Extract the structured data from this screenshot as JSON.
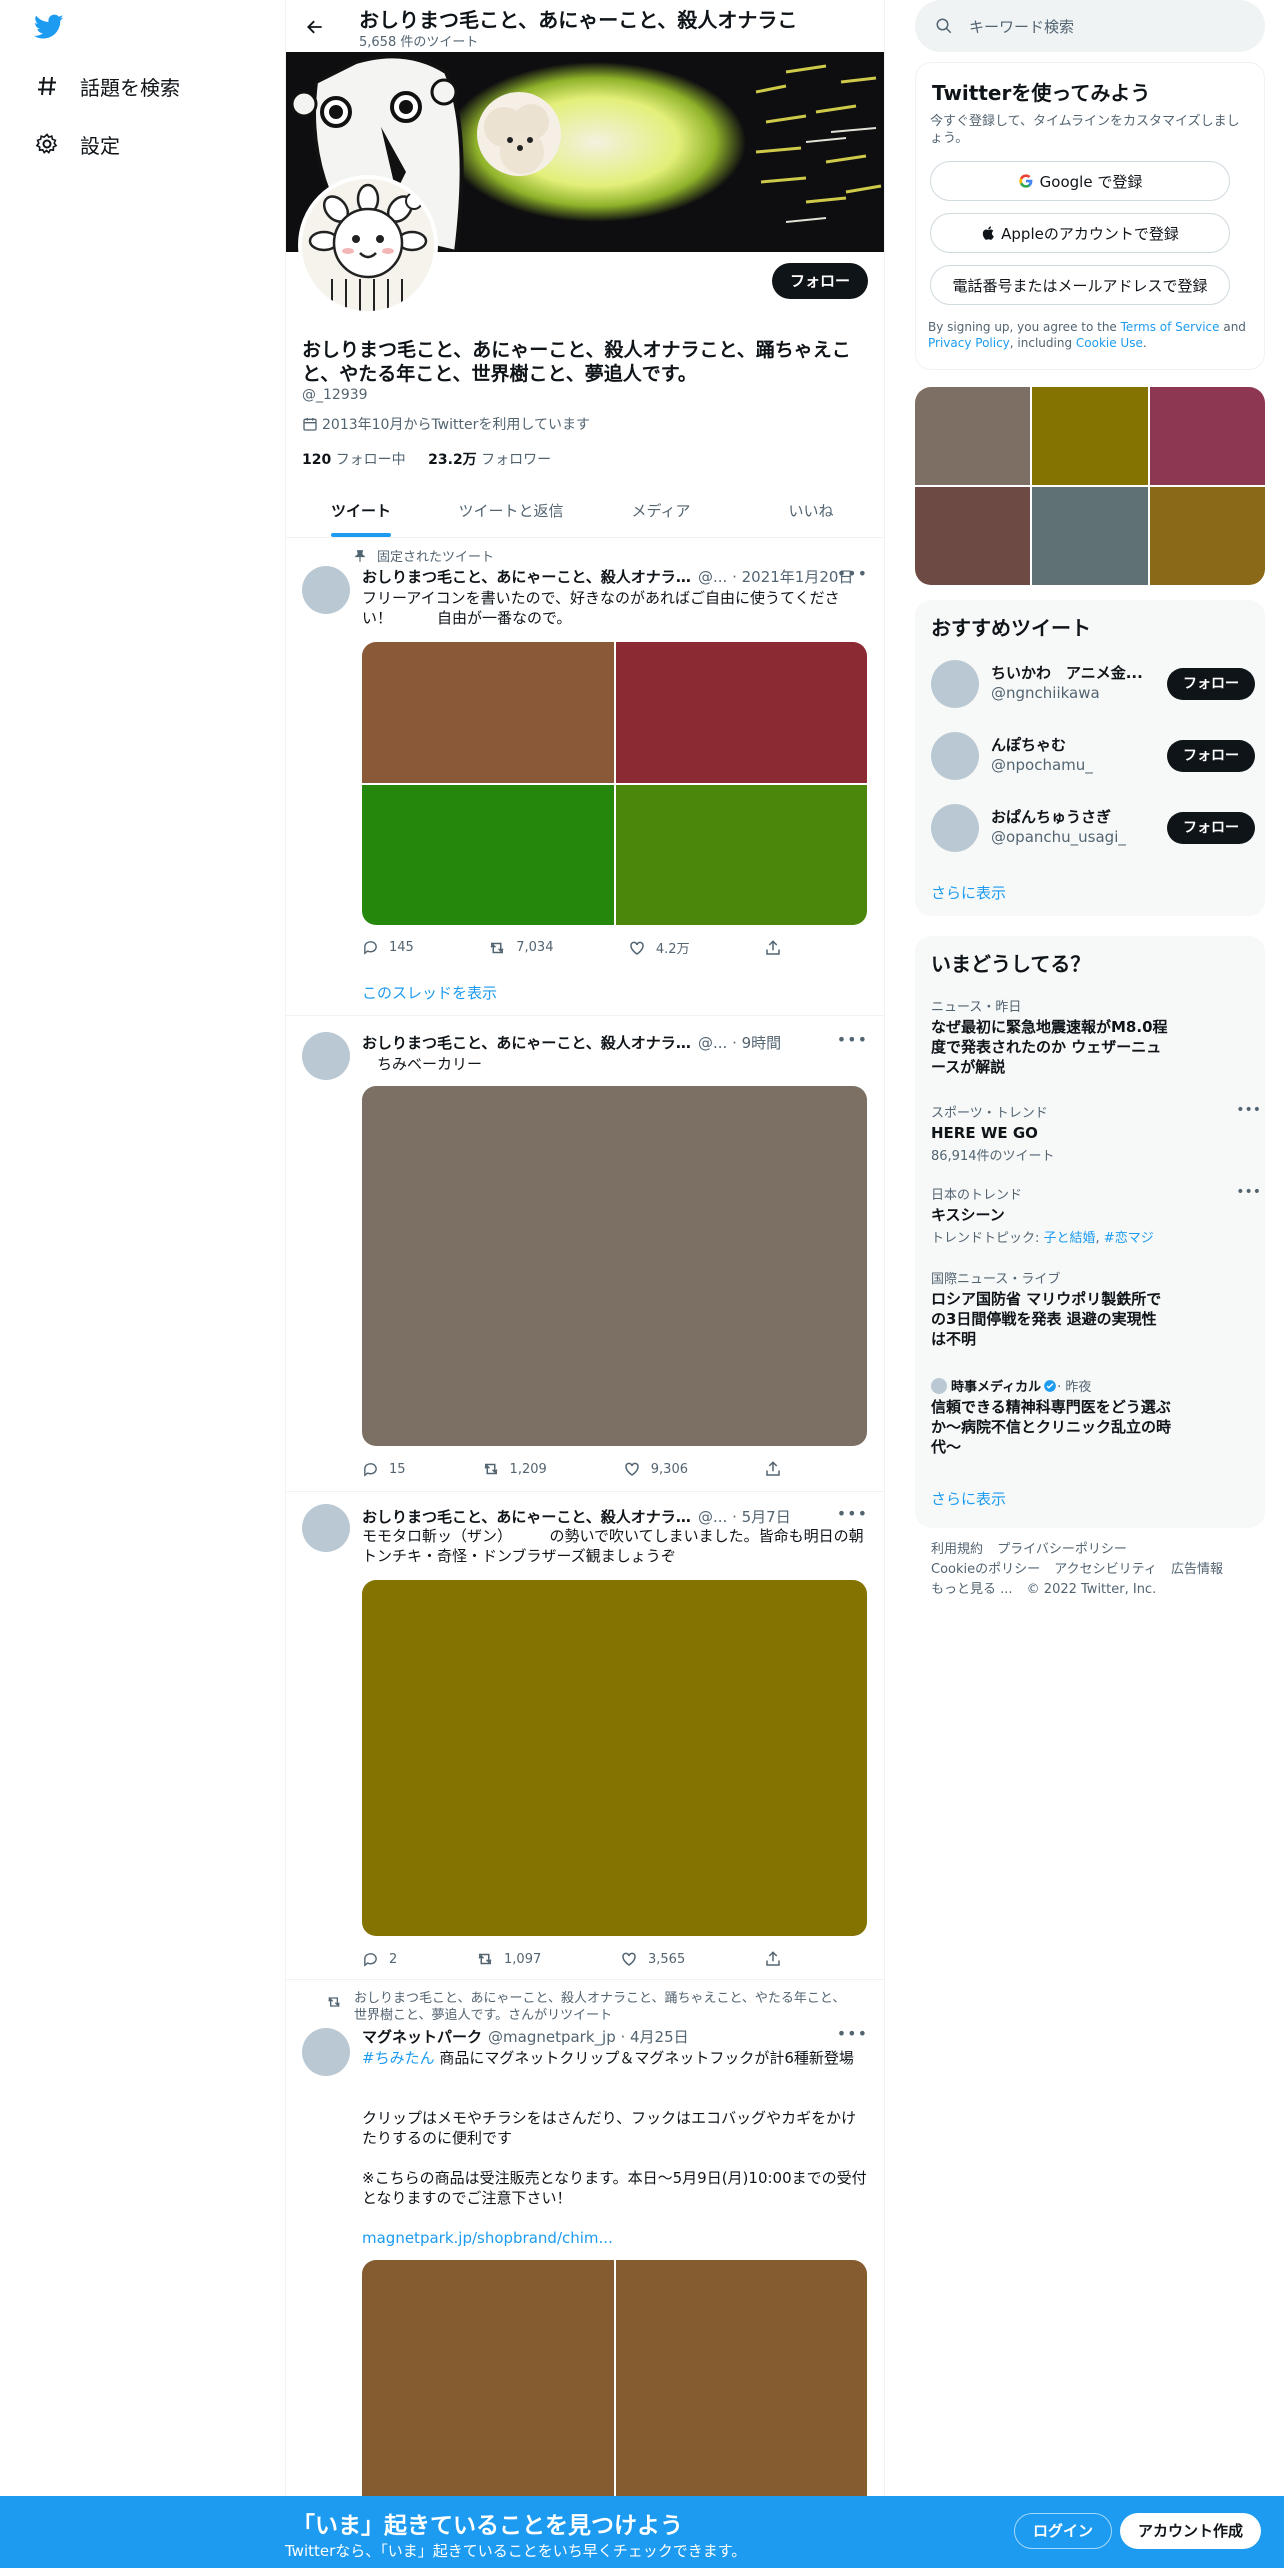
{
  "nav": {
    "explore_label": "話題を検索",
    "settings_label": "設定"
  },
  "header": {
    "title": "おしりまつ毛こと、あにゃーこと、殺人オナラこ",
    "tweet_count": "5,658 件のツイート"
  },
  "profile": {
    "follow_label": "フォロー",
    "name": "おしりまつ毛こと、あにゃーこと、殺人オナラこと、踊ちゃえこと、やたる年こと、世界樹こと、夢追人です。",
    "handle": "@_12939",
    "joined": "2013年10月からTwitterを利用しています",
    "following_count": "120",
    "following_label": "フォロー中",
    "followers_count": "23.2万",
    "followers_label": "フォロワー"
  },
  "tabs": [
    {
      "label": "ツイート"
    },
    {
      "label": "ツイートと返信"
    },
    {
      "label": "メディア"
    },
    {
      "label": "いいね"
    }
  ],
  "tweets": [
    {
      "context": "固定されたツイート",
      "name": "おしりまつ毛こと、あにゃーこと、殺人オナラ...",
      "meta": "@... · 2021年1月20日",
      "text": "フリーアイコンを書いたので、好きなのがあればご自由に使うてください！　　　自由が一番なので。",
      "media_colors": [
        "#8a5a38",
        "#8c2a33",
        "#25870b",
        "#4a870a"
      ],
      "reply": "145",
      "retweet": "7,034",
      "like": "4.2万",
      "show_thread": "このスレッドを表示"
    },
    {
      "name": "おしりまつ毛こと、あにゃーこと、殺人オナラこと、踊...",
      "meta": "@... · 9時間",
      "text": "　ちみベーカリー",
      "media_colors": [
        "#7c6f63"
      ],
      "reply": "15",
      "retweet": "1,209",
      "like": "9,306"
    },
    {
      "name": "おしりまつ毛こと、あにゃーこと、殺人オナラこと、踊...",
      "meta": "@... · 5月7日",
      "text": "モモタロ斬ッ（ザン）　　　の勢いで吹いてしまいました。皆命も明日の朝トンチキ・奇怪・ドンブラザーズ観ましょうぞ",
      "media_colors": [
        "#847300"
      ],
      "reply": "2",
      "retweet": "1,097",
      "like": "3,565"
    },
    {
      "context": "おしりまつ毛こと、あにゃーこと、殺人オナラこと、踊ちゃえこと、やたる年こと、世界樹こと、夢追人です。さんがリツイート",
      "name": "マグネットパーク",
      "meta": "@magnetpark_jp · 4月25日",
      "hashtag": "#ちみたん",
      "text_after_tag": " 商品にマグネットクリップ＆マグネットフックが計6種新登場",
      "text2": "クリップはメモやチラシをはさんだり、フックはエコバッグやカギをかけたりするのに便利です",
      "text3": "※こちらの商品は受注販売となります。本日～5月9日(月)10:00までの受付となりますのでご注意下さい！",
      "link": "magnetpark.jp/shopbrand/chim...",
      "media_colors": [
        "#855b30",
        "#855b30"
      ]
    }
  ],
  "right": {
    "search_placeholder": "キーワード検索",
    "signup": {
      "title": "Twitterを使ってみよう",
      "sub": "今すぐ登録して、タイムラインをカスタマイズしましょう。",
      "google": "Google で登録",
      "apple": "Appleのアカウントで登録",
      "phone": "電話番号またはメールアドレスで登録",
      "terms_pre": "By signing up, you agree to the ",
      "terms_link": "Terms of Service",
      "terms_and": " and ",
      "privacy_link": "Privacy Policy",
      "terms_inc": ", including ",
      "cookie_link": "Cookie Use",
      "terms_end": "."
    },
    "photos": [
      "#7d6f63",
      "#847300",
      "#8e3752",
      "#6d4b44",
      "#5f7172",
      "#8a6a18"
    ],
    "recommend": {
      "title": "おすすめツイート",
      "users": [
        {
          "name": "ちいかわ　アニメ金...",
          "handle": "@ngnchiikawa"
        },
        {
          "name": "んぽちゃむ",
          "handle": "@npochamu_"
        },
        {
          "name": "おぱんちゅうさぎ",
          "handle": "@opanchu_usagi_"
        }
      ],
      "follow_label": "フォロー",
      "more": "さらに表示"
    },
    "trends": {
      "title": "いまどうしてる？",
      "items": [
        {
          "category": "ニュース・昨日",
          "title": "なぜ最初に緊急地震速報がM8.0程度で発表されたのか ウェザーニュースが解説"
        },
        {
          "category": "スポーツ・トレンド",
          "title": "HERE WE GO",
          "count": "86,914件のツイート"
        },
        {
          "category": "日本のトレンド",
          "title": "キスシーン",
          "topic_label": "トレンドトピック: ",
          "topic1": "子と結婚",
          "topic2": "#恋マジ"
        },
        {
          "category": "国際ニュース・ライブ",
          "title": "ロシア国防省 マリウポリ製鉄所での3日間停戦を発表 退避の実現性は不明"
        },
        {
          "source": "時事メディカル",
          "when": " · 昨夜",
          "title": "信頼できる精神科専門医をどう選ぶか～病院不信とクリニック乱立の時代～"
        }
      ],
      "more": "さらに表示"
    },
    "footer": {
      "terms": "利用規約",
      "privacy": "プライバシーポリシー",
      "cookie": "Cookieのポリシー",
      "access": "アクセシビリティ",
      "ads": "広告情報",
      "more": "もっと見る ...",
      "copyright": "© 2022 Twitter, Inc."
    }
  },
  "bottom": {
    "title": "「いま」起きていることを見つけよう",
    "sub": "Twitterなら、「いま」起きていることをいち早くチェックできます。",
    "login": "ログイン",
    "signup": "アカウント作成"
  },
  "colors": {
    "accent": "#1d9bf0",
    "text": "#0f1419",
    "muted": "#536471"
  }
}
